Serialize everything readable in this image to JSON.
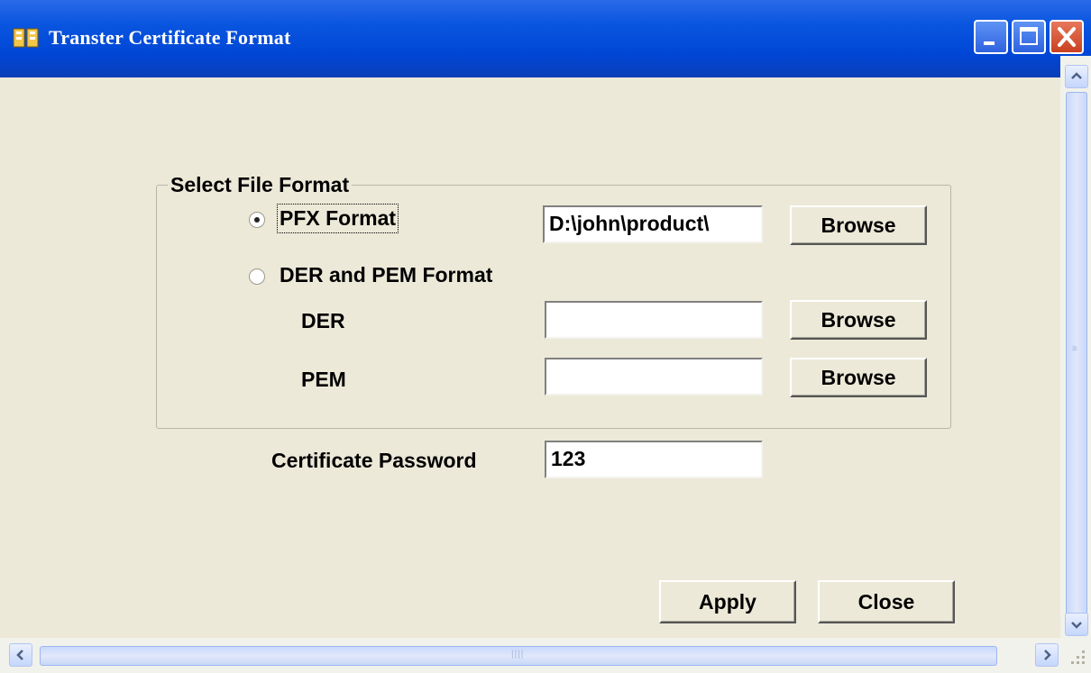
{
  "window": {
    "title": "Transter Certificate Format"
  },
  "group": {
    "legend": "Select File Format",
    "pfx_radio": {
      "label": "PFX Format",
      "checked": true
    },
    "pfx_path": "D:\\john\\product\\",
    "der_pem_radio": {
      "label": "DER and PEM Format",
      "checked": false
    },
    "der_label": "DER",
    "der_path": "",
    "pem_label": "PEM",
    "pem_path": "",
    "browse_label": "Browse"
  },
  "password": {
    "label": "Certificate Password",
    "value": "123"
  },
  "buttons": {
    "apply": "Apply",
    "close": "Close"
  },
  "icons": [
    "app-icon",
    "minimize-icon",
    "maximize-icon",
    "close-icon",
    "scroll-up-icon",
    "scroll-down-icon",
    "scroll-left-icon",
    "scroll-right-icon",
    "resize-grip-icon"
  ],
  "colors": {
    "titlebar": "#0a56e0",
    "face": "#ece9d8",
    "close_button": "#d95a3a"
  }
}
